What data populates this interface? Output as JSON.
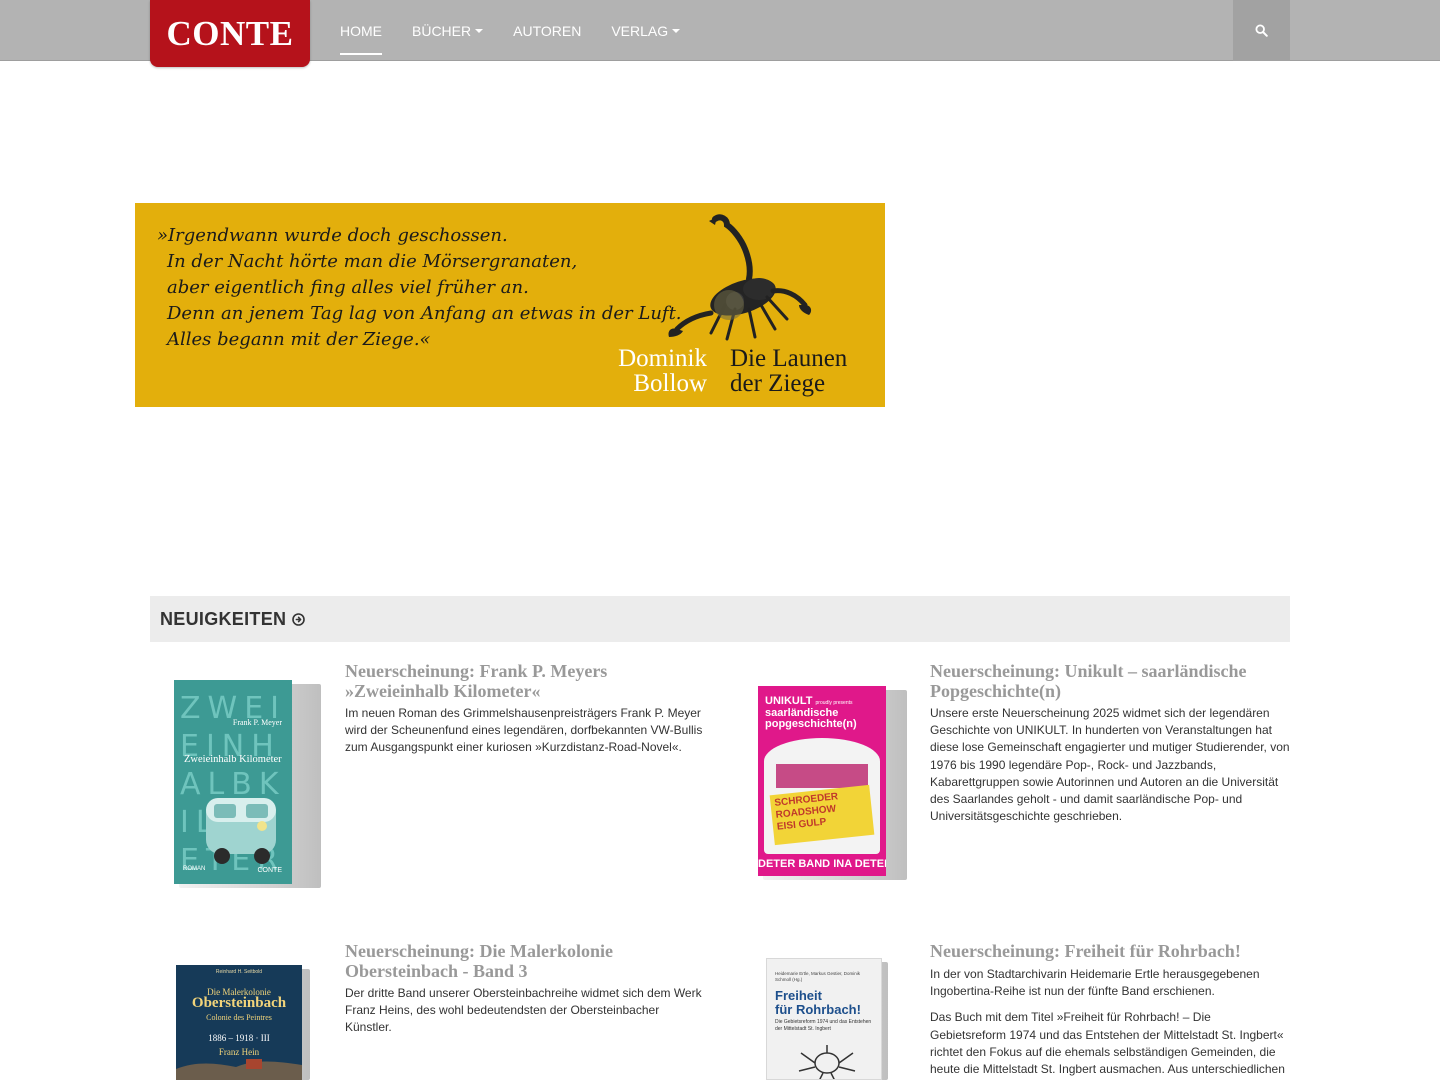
{
  "header": {
    "logo": "CONTE",
    "nav": [
      {
        "label": "Home",
        "active": true
      },
      {
        "label": "Bücher",
        "dropdown": true
      },
      {
        "label": "Autoren"
      },
      {
        "label": "Verlag",
        "dropdown": true
      }
    ],
    "search_icon": "search-icon"
  },
  "banner": {
    "quote_lines": [
      "»Irgendwann wurde doch geschossen.",
      "In der Nacht hörte man die Mörsergranaten,",
      "aber eigentlich fing alles viel früher an.",
      "Denn an jenem Tag lag von Anfang an etwas in der Luft.",
      "Alles begann mit der Ziege.«"
    ],
    "author_first": "Dominik",
    "author_last": "Bollow",
    "title_1": "Die Launen",
    "title_2": "der Ziege",
    "bg_color": "#e3af0c"
  },
  "news": {
    "heading": "Neuigkeiten",
    "items": [
      {
        "title": "Neuerscheinung: Frank P. Meyers »Zweieinhalb Kilometer«",
        "paragraphs": [
          "Im neuen Roman des Grimmelshausenpreisträgers Frank P. Meyer wird der Scheunenfund eines legendären, dorfbekannten VW-Bullis zum Ausgangspunkt einer kuriosen »Kurzdistanz-Road-Novel«."
        ],
        "cover": {
          "letters": "ZWEIEINHALBKILOMETER",
          "author": "Frank P. Meyer",
          "title": "Zweieinhalb Kilometer",
          "genre": "ROMAN",
          "publisher": "CONTE",
          "color": "#3d9a94"
        }
      },
      {
        "title": "Neuerscheinung: Unikult – saarländische Popgeschichte(n)",
        "paragraphs": [
          "Unsere erste Neuerscheinung 2025 widmet sich der legendären Geschichte von UNIKULT. In hunderten von Veranstaltungen hat diese lose Gemeinschaft engagierter und mutiger Studierender, von 1976 bis 1990 legendäre Pop-, Rock- und Jazzbands, Kabarettgruppen sowie Autorinnen und Autoren an die Universität des Saarlandes geholt - und damit saarländische Pop- und Universitätsgeschichte geschrieben."
        ],
        "cover": {
          "brand": "UNIKULT",
          "brand_sub": "proudly presents",
          "title_1": "saarländische",
          "title_2": "popgeschichte(n)",
          "poster_1": "SCHROEDER",
          "poster_2": "ROADSHOW",
          "poster_3": "EISI GULP",
          "bottom_1": "DETER BAND",
          "bottom_2": "INA DETER",
          "color": "#e0188a"
        }
      },
      {
        "title": "Neuerscheinung: Die Malerkolonie Obersteinbach - Band 3",
        "paragraphs": [
          "Der dritte Band unserer Obersteinbachreihe widmet sich dem Werk Franz Heins, des wohl bedeutendsten der Obersteinbacher Künstler."
        ],
        "cover": {
          "editors": "Reinhard H. Seitbold",
          "title_1": "Die Malerkolonie",
          "title_2": "Obersteinbach",
          "title_3": "Colonie des Peintres",
          "years": "1886 – 1918 · III",
          "name": "Franz Hein",
          "color": "#163a58"
        }
      },
      {
        "title": "Neuerscheinung: Freiheit für Rohrbach!",
        "paragraphs": [
          "In der von Stadtarchivarin Heidemarie Ertle herausgegebenen Ingobertina-Reihe ist nun der fünfte Band erschienen.",
          "Das Buch mit dem Titel »Freiheit für Rohrbach! – Die Gebietsreform 1974 und das Entstehen der Mittelstadt St. Ingbert« richtet den Fokus auf die ehemals selbständigen Gemeinden, die heute die Mittelstadt St. Ingbert ausmachen. Aus unterschiedlichen"
        ],
        "cover": {
          "editors": "Heidemarie Ertle, Markus Gestier, Dominik Schmoll (Hg.)",
          "title_1": "Freiheit",
          "title_2": "für Rohrbach!",
          "subtitle": "Die Gebietsreform 1974 und das Entstehen der Mittelstadt St. Ingbert",
          "color": "#f1f1f1"
        }
      }
    ]
  }
}
